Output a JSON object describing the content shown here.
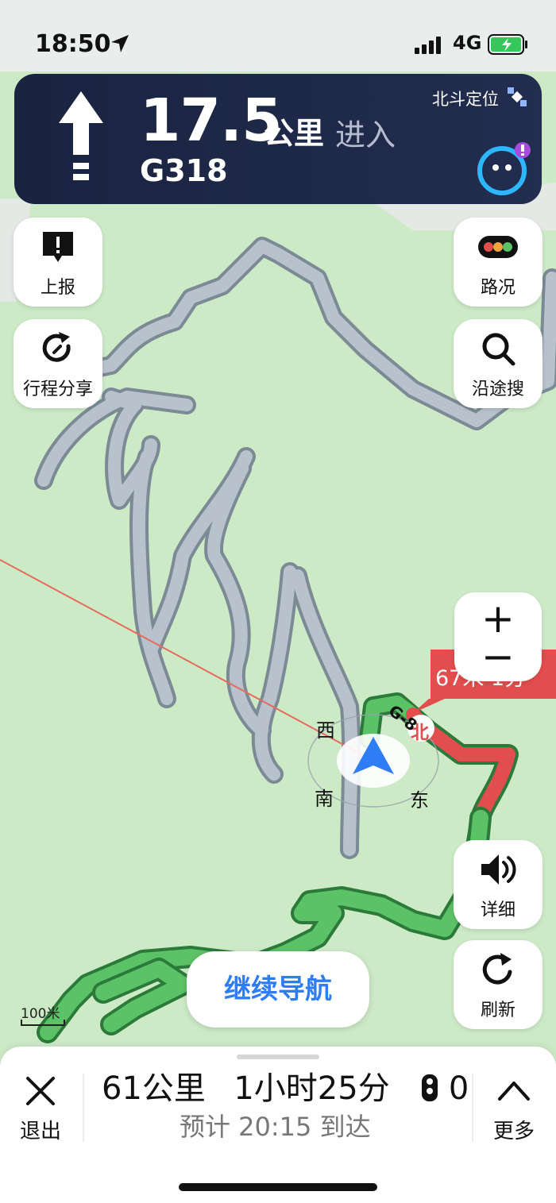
{
  "status_bar": {
    "time": "18:50",
    "network": "4G"
  },
  "nav": {
    "distance": "17.5",
    "distance_unit": "公里",
    "action": "进入",
    "road": "G318",
    "positioning": "北斗定位"
  },
  "left_buttons": {
    "report": "上报",
    "share": "行程分享"
  },
  "right_buttons": {
    "traffic": "路况",
    "search_along": "沿途搜",
    "details": "详细",
    "refresh": "刷新"
  },
  "zoom": {
    "plus": "+",
    "minus": "−"
  },
  "map": {
    "compass": {
      "north": "北",
      "south": "南",
      "east": "东",
      "west": "西"
    },
    "route_tag": "G-8",
    "callout": "67米 1分",
    "scale": "100米"
  },
  "continue_nav": "继续导航",
  "bottom": {
    "exit": "退出",
    "distance": "61公里",
    "duration": "1小时25分",
    "lights": "0",
    "eta": "预计 20:15 到达",
    "more": "更多"
  },
  "colors": {
    "route_green": "#5cc267",
    "route_red": "#e24d4d",
    "accent_blue": "#2f7df6",
    "nav_bg": "#1c2646"
  }
}
